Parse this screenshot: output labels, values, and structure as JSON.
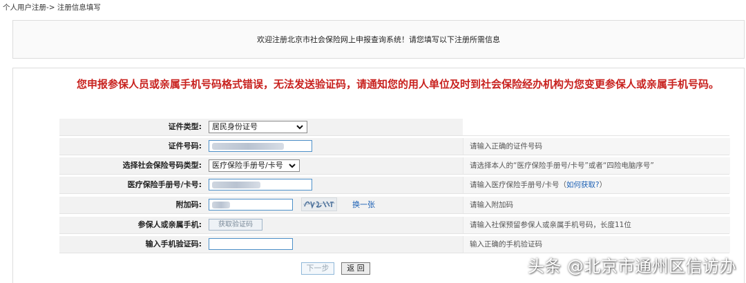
{
  "breadcrumb": "个人用户注册-> 注册信息填写",
  "welcome": "欢迎注册北京市社会保险网上申报查询系统！请您填写以下注册所需信息",
  "error_message": "您申报参保人员或亲属手机号码格式错误，无法发送验证码，请通知您的用人单位及时到社会保险经办机构为您变更参保人或亲属手机号码。",
  "form": {
    "id_type": {
      "label": "证件类型:",
      "value": "居民身份证号"
    },
    "id_number": {
      "label": "证件号码:",
      "hint": "请输入正确的证件号码"
    },
    "insurance_type": {
      "label": "选择社会保险号码类型:",
      "value": "医疗保险手册号/卡号",
      "hint": "请选择本人的“医疗保险手册号/卡号”或者“四险电脑序号”"
    },
    "medical_card": {
      "label": "医疗保险手册号/卡号:",
      "hint": "请输入医疗保险手册号/卡号（",
      "hint_link": "如何获取?",
      "hint_end": "）"
    },
    "captcha": {
      "label": "附加码:",
      "refresh_link": "换一张",
      "hint": "请输入附加码"
    },
    "phone": {
      "label": "参保人或亲属手机:",
      "button": "获取验证码",
      "hint": "请输入社保预留参保人或亲属手机号码，长度11位"
    },
    "sms_code": {
      "label": "输入手机验证码:",
      "hint": "输入正确的手机验证码"
    }
  },
  "buttons": {
    "next": "下一步",
    "back": "返 回"
  },
  "watermark": "头条 @北京市通州区信访办",
  "colors": {
    "error": "#c8211e",
    "link": "#1a5fb4",
    "input_border": "#4d90c9"
  }
}
